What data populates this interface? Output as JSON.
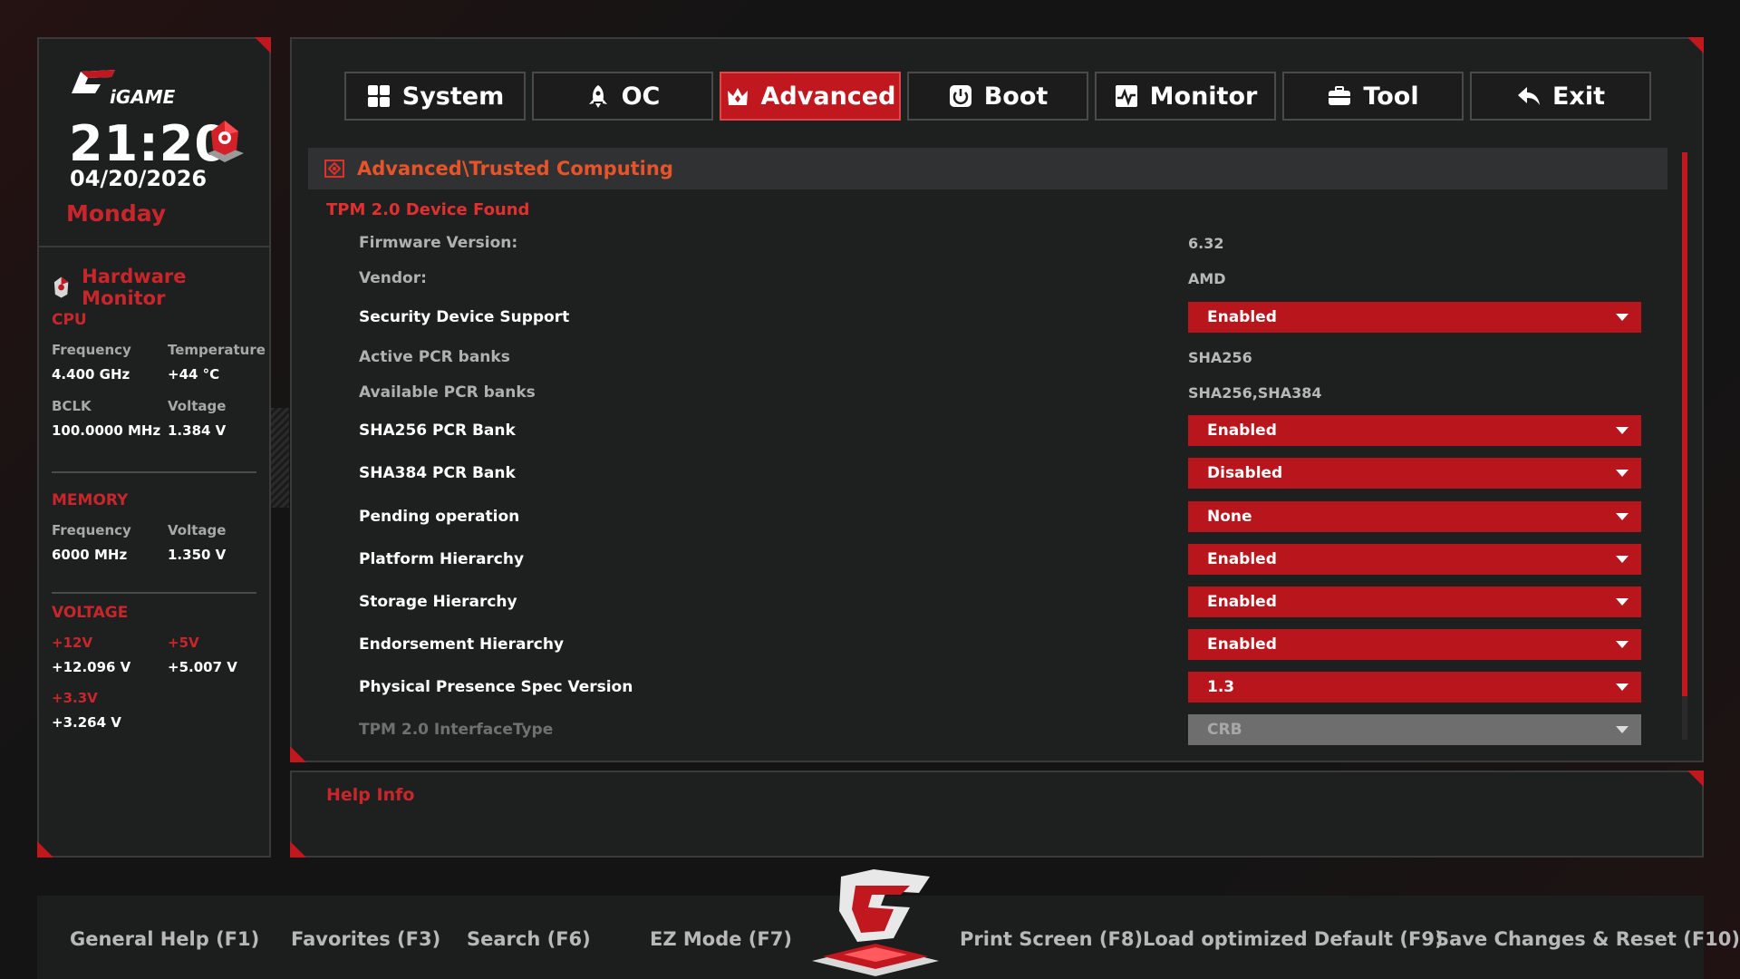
{
  "sidebar": {
    "time": "21:20",
    "date": "04/20/2026",
    "day": "Monday",
    "hw_title": "Hardware Monitor",
    "cpu": {
      "title": "CPU",
      "frequency_label": "Frequency",
      "frequency": "4.400 GHz",
      "temperature_label": "Temperature",
      "temperature": "+44 °C",
      "bclk_label": "BCLK",
      "bclk": "100.0000 MHz",
      "voltage_label": "Voltage",
      "voltage": "1.384 V"
    },
    "memory": {
      "title": "MEMORY",
      "frequency_label": "Frequency",
      "frequency": "6000 MHz",
      "voltage_label": "Voltage",
      "voltage": "1.350 V"
    },
    "voltage": {
      "title": "VOLTAGE",
      "v12_label": "+12V",
      "v12": "+12.096 V",
      "v5_label": "+5V",
      "v5": "+5.007 V",
      "v33_label": "+3.3V",
      "v33": "+3.264 V"
    }
  },
  "tabs": [
    {
      "label": "System",
      "icon": "grid-icon"
    },
    {
      "label": "OC",
      "icon": "rocket-icon"
    },
    {
      "label": "Advanced",
      "icon": "crown-icon"
    },
    {
      "label": "Boot",
      "icon": "power-icon"
    },
    {
      "label": "Monitor",
      "icon": "pulse-icon"
    },
    {
      "label": "Tool",
      "icon": "toolbox-icon"
    },
    {
      "label": "Exit",
      "icon": "back-arrow-icon"
    }
  ],
  "active_tab": "Advanced",
  "breadcrumb": "Advanced\\Trusted Computing",
  "tpm_found": "TPM 2.0 Device Found",
  "settings": [
    {
      "label": "Firmware Version:",
      "value": "6.32"
    },
    {
      "label": "Vendor:",
      "value": "AMD"
    },
    {
      "label": "Security Device Support",
      "select": "Enabled"
    },
    {
      "label": "Active PCR banks",
      "value": "SHA256"
    },
    {
      "label": "Available PCR banks",
      "value": "SHA256,SHA384"
    },
    {
      "label": "SHA256 PCR Bank",
      "select": "Enabled"
    },
    {
      "label": "SHA384 PCR Bank",
      "select": "Disabled"
    },
    {
      "label": "Pending operation",
      "select": "None"
    },
    {
      "label": "Platform Hierarchy",
      "select": "Enabled"
    },
    {
      "label": "Storage Hierarchy",
      "select": "Enabled"
    },
    {
      "label": "Endorsement Hierarchy",
      "select": "Enabled"
    },
    {
      "label": "Physical Presence Spec Version",
      "select": "1.3"
    },
    {
      "label": "TPM 2.0 InterfaceType",
      "select": "CRB"
    }
  ],
  "help": {
    "title": "Help Info"
  },
  "footer": {
    "f1": "General Help (F1)",
    "f3": "Favorites (F3)",
    "f6": "Search (F6)",
    "f7": "EZ Mode (F7)",
    "f8": "Print Screen (F8)",
    "f9": "Load optimized Default (F9)",
    "f10": "Save Changes & Reset (F10)"
  },
  "colors": {
    "accent": "#c0181e",
    "accent_text": "#c9262c",
    "breadcrumb": "#e8542a",
    "panel": "#1e1f1f"
  }
}
